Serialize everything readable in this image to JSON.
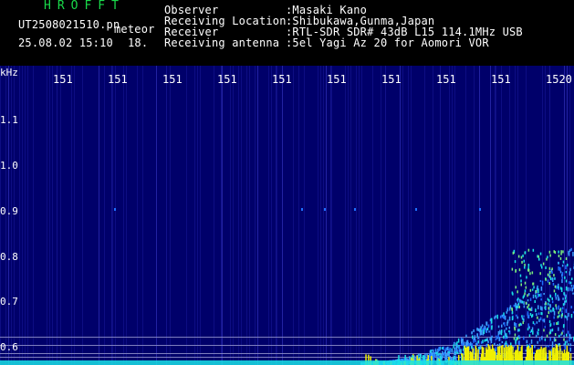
{
  "header": {
    "brand": "HROFFT",
    "file_name": "UT2508021510.pn",
    "tag": "meteor",
    "date_time": "25.08.02 15:10",
    "counter": "18.",
    "fields": [
      {
        "label": "Observer",
        "value": ":Masaki Kano"
      },
      {
        "label": "Receiving Location",
        "value": ":Shibukawa,Gunma,Japan"
      },
      {
        "label": "Receiver",
        "value": ":RTL-SDR SDR# 43dB L15 114.1MHz USB"
      },
      {
        "label": "Receiving antenna",
        "value": ":5el Yagi Az 20 for Aomori VOR"
      }
    ]
  },
  "axes": {
    "y_unit": "kHz",
    "y_ticks": [
      "1.1",
      "1.0",
      "0.9",
      "0.8",
      "0.7",
      "0.6"
    ],
    "x_ticks": [
      "151",
      "151",
      "151",
      "151",
      "151",
      "151",
      "151",
      "151",
      "151",
      "1520"
    ]
  },
  "colors": {
    "background": "#00006a",
    "signal_low": "#1e6fff",
    "signal_mid": "#19e0e6",
    "signal_high": "#f0f000",
    "brand": "#19d94a"
  }
}
